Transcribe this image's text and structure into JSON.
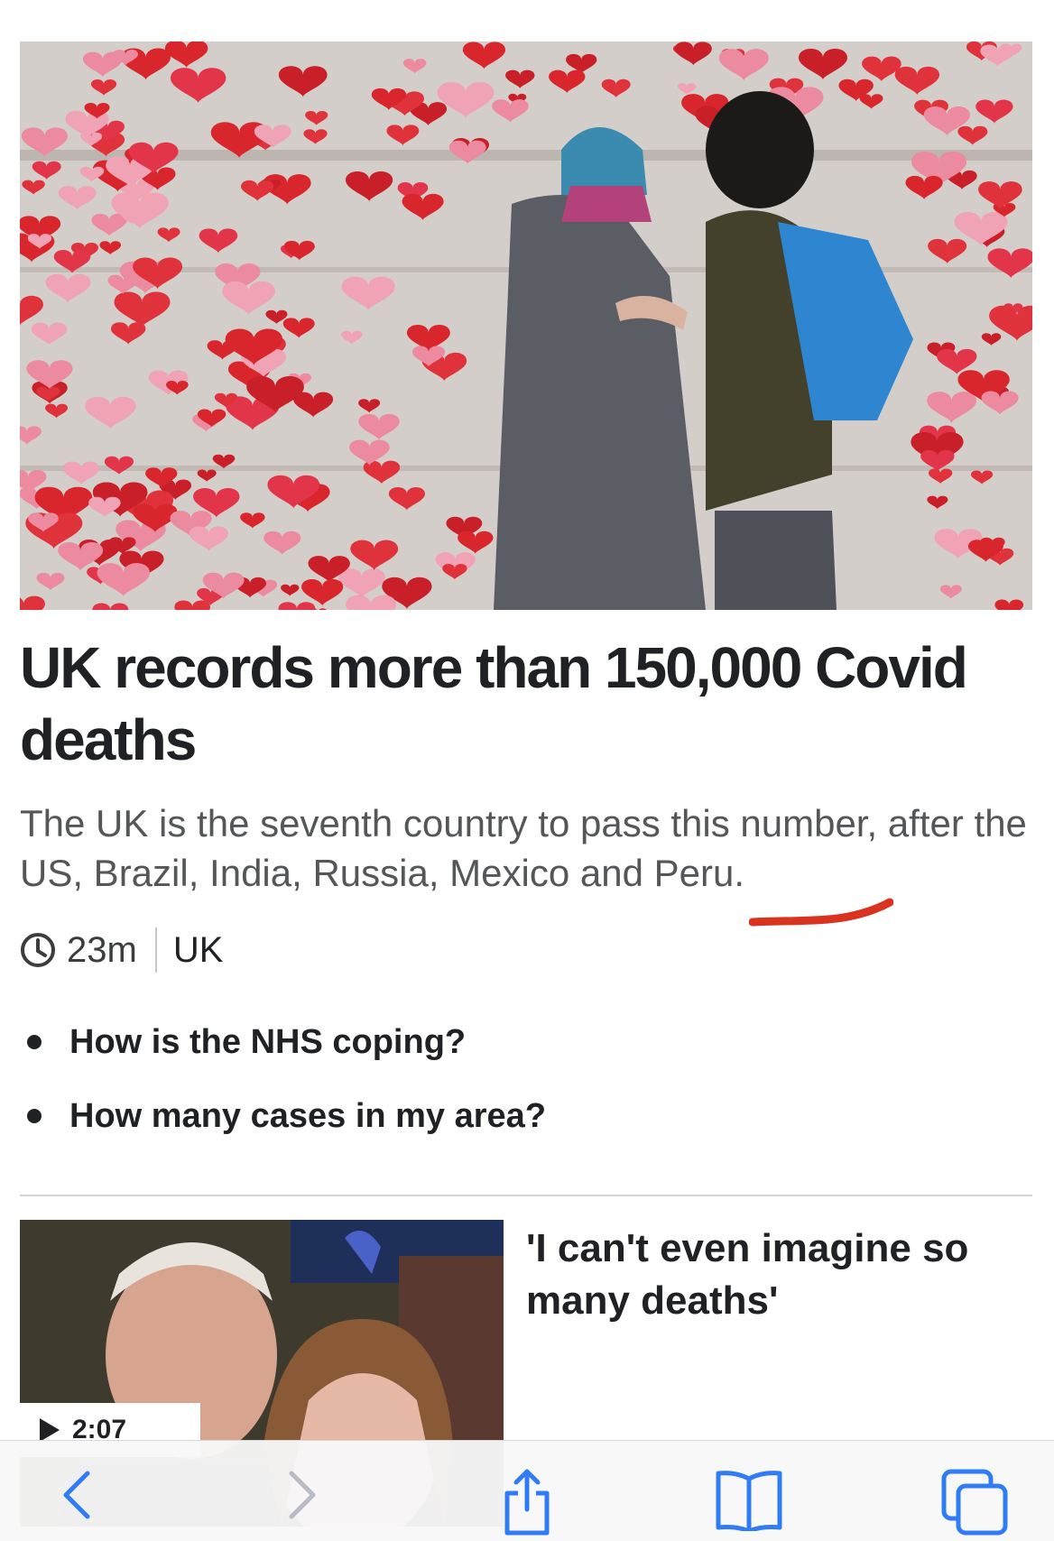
{
  "article": {
    "headline": "UK records more than 150,000 Covid deaths",
    "summary": "The UK is the seventh country to pass this number, after the US, Brazil, India, Russia, Mexico and Peru.",
    "time_ago": "23m",
    "section": "UK",
    "related_links": [
      "How is the NHS coping?",
      "How many cases in my area?"
    ]
  },
  "next_story": {
    "title": "'I can't even imagine so many deaths'",
    "video_duration": "2:07"
  },
  "browser_toolbar": {
    "buttons": [
      "back-icon",
      "forward-icon",
      "share-icon",
      "bookmarks-icon",
      "tabs-icon"
    ],
    "accent_color": "#2f7cf6",
    "disabled_color": "#b9bcc2"
  },
  "colors": {
    "annotation_scribble": "#d9331f"
  }
}
